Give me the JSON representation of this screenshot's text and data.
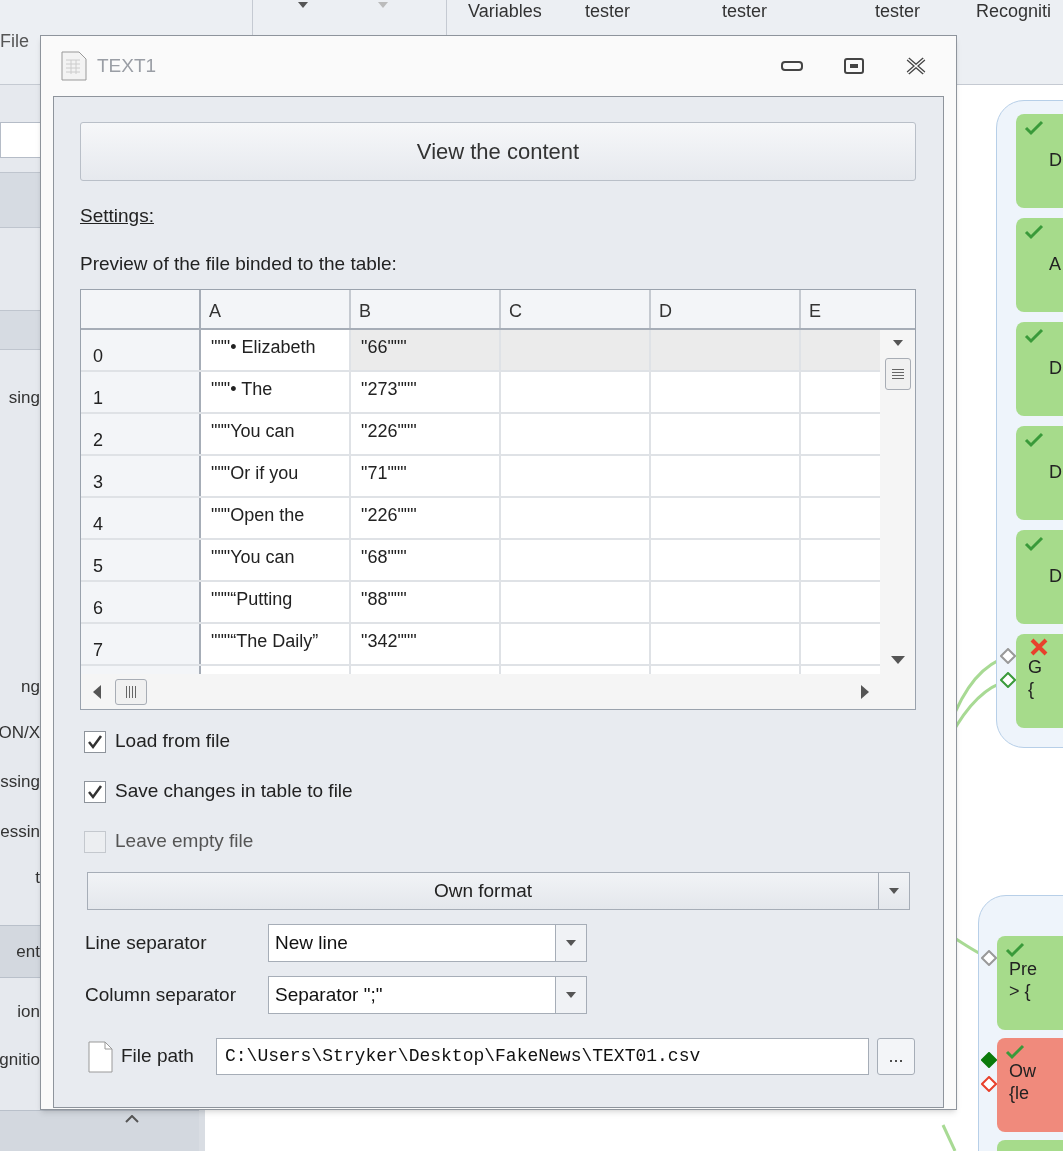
{
  "ribbon": {
    "file_tab": "File",
    "items": [
      "Variables",
      "tester",
      "tester",
      "tester",
      "Recogniti"
    ]
  },
  "sidebar": {
    "items": [
      {
        "label": "sing",
        "selected": false
      },
      {
        "label": "ng",
        "selected": false
      },
      {
        "label": "ON/X",
        "selected": false
      },
      {
        "label": "ssing",
        "selected": false
      },
      {
        "label": "essin",
        "selected": false
      },
      {
        "label": "t",
        "selected": false
      },
      {
        "label": "ent",
        "selected": true
      },
      {
        "label": "ion",
        "selected": false
      },
      {
        "label": "gnitio",
        "selected": false
      }
    ]
  },
  "canvas": {
    "groups": [
      {
        "nodes": [
          {
            "lines": [
              "D"
            ],
            "failed": false,
            "color": "#a6db8b"
          },
          {
            "lines": [
              "A"
            ],
            "failed": false,
            "color": "#a6db8b"
          },
          {
            "lines": [
              "D"
            ],
            "failed": false,
            "color": "#a6db8b"
          },
          {
            "lines": [
              "D"
            ],
            "failed": false,
            "color": "#a6db8b"
          },
          {
            "lines": [
              "D"
            ],
            "failed": false,
            "color": "#a6db8b"
          },
          {
            "lines": [
              "G",
              "{"
            ],
            "failed": true,
            "color": "#a6db8b",
            "ports": [
              {
                "kind": "neutral"
              },
              {
                "kind": "success"
              }
            ]
          }
        ]
      },
      {
        "nodes": [
          {
            "lines": [
              "Pre",
              "> {"
            ],
            "failed": false,
            "color": "#a6db8b",
            "ports": [
              {
                "kind": "neutral"
              }
            ]
          },
          {
            "lines": [
              "Ow",
              "{le"
            ],
            "failed": false,
            "color": "#f08a7c",
            "ports": [
              {
                "kind": "filled"
              },
              {
                "kind": "failure"
              }
            ]
          },
          {
            "color": "#a6db8b"
          }
        ]
      }
    ]
  },
  "dialog": {
    "title": "TEXT1",
    "view_button": "View the content",
    "settings_label": "Settings:",
    "preview_label": "Preview of the file binded to the table:",
    "table": {
      "columns": [
        "A",
        "B",
        "C",
        "D",
        "E"
      ],
      "rows": [
        {
          "index": "0",
          "cells": [
            "\"\"\"• Elizabeth",
            "\"66\"\"\""
          ],
          "selected": true
        },
        {
          "index": "1",
          "cells": [
            "\"\"\"• The",
            "\"273\"\"\""
          ],
          "selected": false
        },
        {
          "index": "2",
          "cells": [
            "\"\"\"You can",
            "\"226\"\"\""
          ],
          "selected": false
        },
        {
          "index": "3",
          "cells": [
            "\"\"\"Or if you",
            "\"71\"\"\""
          ],
          "selected": false
        },
        {
          "index": "4",
          "cells": [
            "\"\"\"Open the",
            "\"226\"\"\""
          ],
          "selected": false
        },
        {
          "index": "5",
          "cells": [
            "\"\"\"You can",
            "\"68\"\"\""
          ],
          "selected": false
        },
        {
          "index": "6",
          "cells": [
            "\"\"\"“Putting",
            "\"88\"\"\""
          ],
          "selected": false
        },
        {
          "index": "7",
          "cells": [
            "\"\"\"“The Daily”",
            "\"342\"\"\""
          ],
          "selected": false
        }
      ]
    },
    "options": [
      {
        "label": "Load from file",
        "checked": true,
        "disabled": false
      },
      {
        "label": "Save changes in table to file",
        "checked": true,
        "disabled": false
      },
      {
        "label": "Leave empty file",
        "checked": false,
        "disabled": true
      }
    ],
    "format": "Own format",
    "line_separator": {
      "label": "Line separator",
      "value": "New line"
    },
    "column_separator": {
      "label": "Column separator",
      "value": "Separator \";\""
    },
    "file_path": {
      "label": "File path",
      "value": "C:\\Users\\Stryker\\Desktop\\FakeNews\\TEXT01.csv",
      "browse": "..."
    }
  }
}
